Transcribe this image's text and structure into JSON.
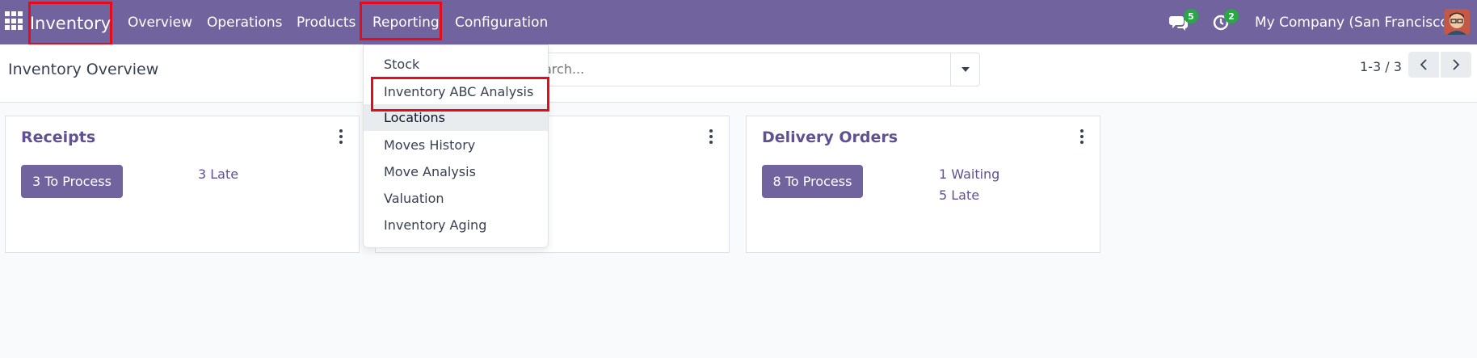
{
  "navbar": {
    "brand": "Inventory",
    "menu": [
      "Overview",
      "Operations",
      "Products",
      "Reporting",
      "Configuration"
    ],
    "messages_badge": "5",
    "activities_badge": "2",
    "company": "My Company (San Francisco)",
    "color": "#71639e"
  },
  "control_panel": {
    "title": "Inventory Overview",
    "search_placeholder": "Search...",
    "pager": "1-3 / 3"
  },
  "reporting_menu": {
    "items": [
      "Stock",
      "Inventory ABC Analysis",
      "Locations",
      "Moves History",
      "Move Analysis",
      "Valuation",
      "Inventory Aging"
    ],
    "hovered": "Locations"
  },
  "cards": [
    {
      "title": "Receipts",
      "button": "3 To Process",
      "stats": [
        "3 Late"
      ]
    },
    {
      "title": "",
      "button": "",
      "stats": []
    },
    {
      "title": "Delivery Orders",
      "button": "8 To Process",
      "stats": [
        "1 Waiting",
        "5 Late"
      ]
    }
  ],
  "highlight_color": "#e40b1b"
}
